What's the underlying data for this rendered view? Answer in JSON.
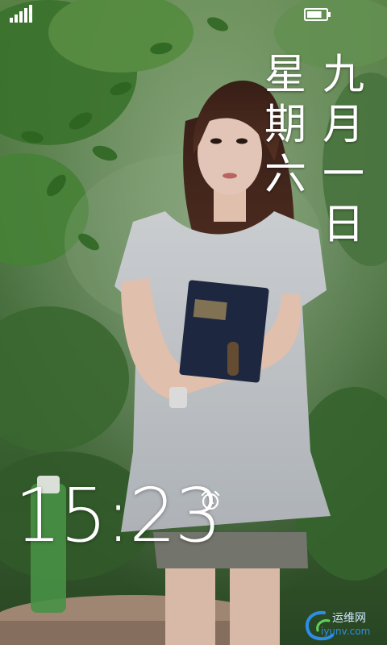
{
  "status_bar": {
    "signal_icon": "signal-strength-icon",
    "battery_icon": "battery-icon",
    "signal_bars": 5,
    "battery_level": 0.8
  },
  "date": {
    "weekday_chars": [
      "星",
      "期",
      "六"
    ],
    "date_chars": [
      "九",
      "月",
      "一",
      "日"
    ]
  },
  "clock": {
    "time": "15:23",
    "alarm_icon": "alarm-clock-icon"
  },
  "watermark": {
    "name": "运维网",
    "url": "iyunv.com"
  },
  "colors": {
    "text": "#ffffff",
    "foliage": "#3f7a34",
    "watermark_blue": "#2d8ee8"
  }
}
